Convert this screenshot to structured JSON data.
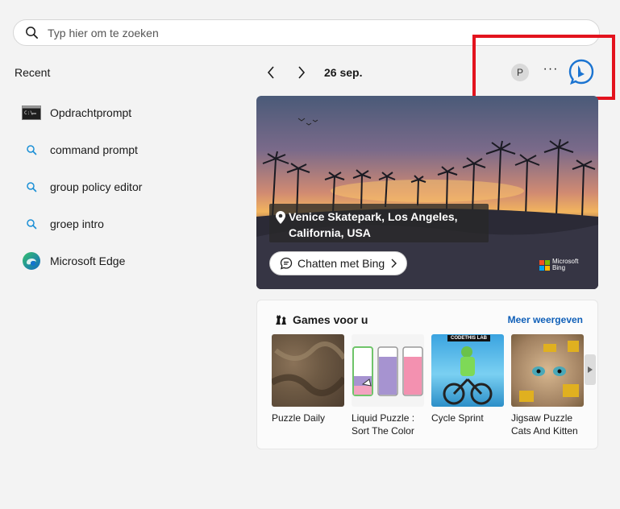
{
  "search": {
    "placeholder": "Typ hier om te zoeken",
    "icon": "search-icon"
  },
  "recent": {
    "title": "Recent",
    "items": [
      {
        "label": "Opdrachtprompt",
        "icon": "cmd-icon"
      },
      {
        "label": "command prompt",
        "icon": "search-icon"
      },
      {
        "label": "group policy editor",
        "icon": "search-icon"
      },
      {
        "label": "groep intro",
        "icon": "search-icon"
      },
      {
        "label": "Microsoft Edge",
        "icon": "edge-icon"
      }
    ]
  },
  "header": {
    "date": "26 sep.",
    "avatar_letter": "P",
    "more_label": "···"
  },
  "hero": {
    "location": "Venice Skatepark, Los Angeles, California, USA",
    "chat_label": "Chatten met Bing",
    "logo_line1": "Microsoft",
    "logo_line2": "Bing"
  },
  "games": {
    "title": "Games voor u",
    "more_label": "Meer weergeven",
    "items": [
      {
        "label": "Puzzle Daily"
      },
      {
        "label": "Liquid Puzzle : Sort The Color"
      },
      {
        "label": "Cycle Sprint",
        "badge": "CODETHIS LAB"
      },
      {
        "label": "Jigsaw Puzzle Cats And Kitten"
      }
    ]
  },
  "colors": {
    "highlight": "#e3131e",
    "link": "#0f5fb8",
    "background": "#f3f3f3"
  }
}
